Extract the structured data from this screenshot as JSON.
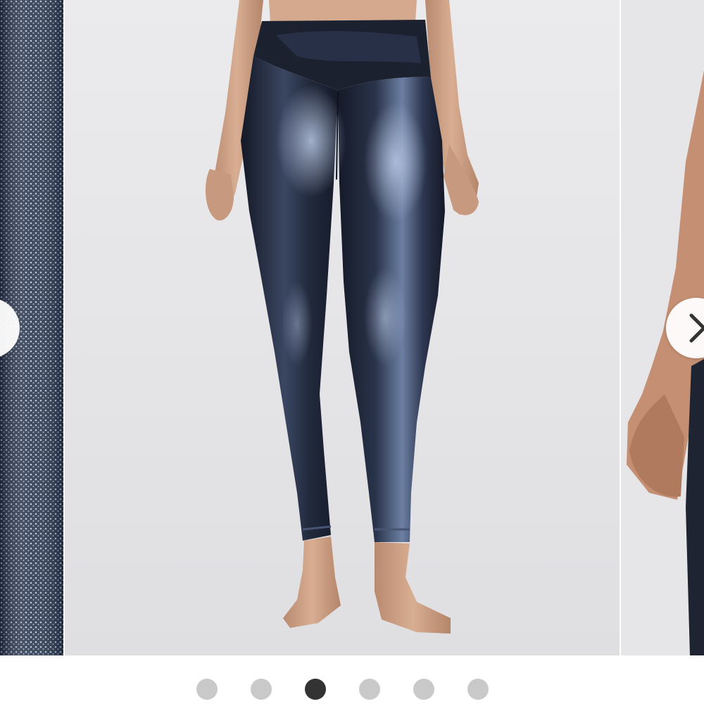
{
  "gallery": {
    "slides": [
      {
        "name": "slide-fabric-detail",
        "icon": "fabric-closeup-image"
      },
      {
        "name": "slide-front-view",
        "icon": "leggings-front-image"
      },
      {
        "name": "slide-side-view",
        "icon": "leggings-side-image"
      }
    ],
    "current_slide": 3,
    "total_slides": 6,
    "prev_icon": "chevron-left-icon",
    "next_icon": "chevron-right-icon"
  },
  "colors": {
    "dot_active": "#333333",
    "dot_inactive": "#c9c9c9",
    "backdrop": "#e6e6e8",
    "garment": "#1f2433"
  }
}
